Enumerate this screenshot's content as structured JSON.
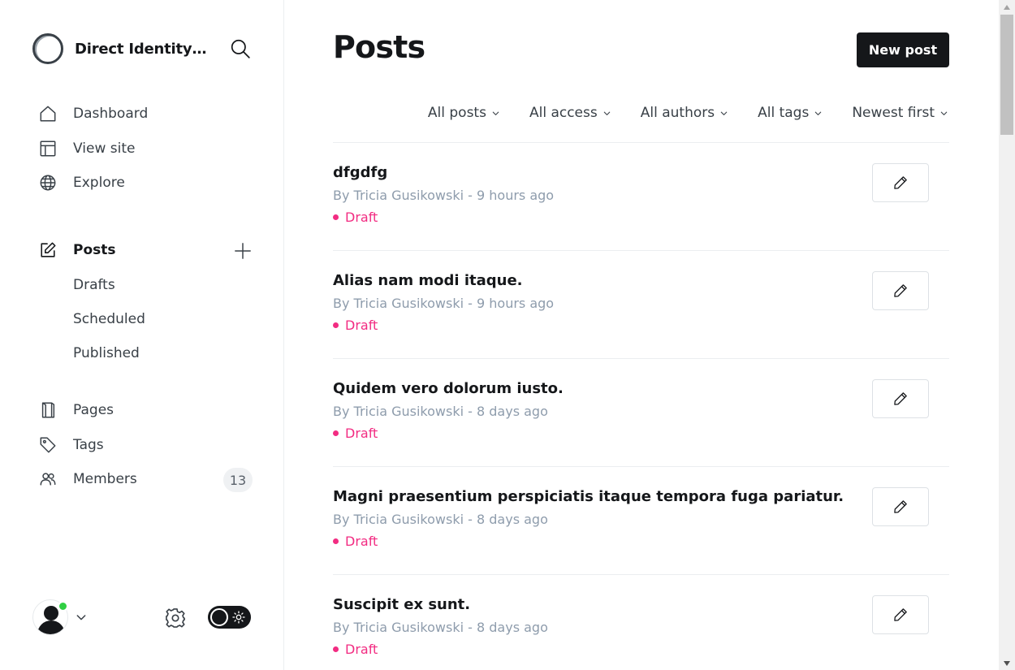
{
  "brand": {
    "name": "Direct Identity S...",
    "logo_icon": "ring-logo-icon"
  },
  "sidebar": {
    "top_items": [
      {
        "label": "Dashboard",
        "icon": "home-icon"
      },
      {
        "label": "View site",
        "icon": "layout-icon"
      },
      {
        "label": "Explore",
        "icon": "globe-icon"
      }
    ],
    "posts": {
      "label": "Posts",
      "icon": "pencil-square-icon",
      "sub_items": [
        "Drafts",
        "Scheduled",
        "Published"
      ]
    },
    "bottom_items": [
      {
        "label": "Pages",
        "icon": "page-icon"
      },
      {
        "label": "Tags",
        "icon": "tag-icon"
      },
      {
        "label": "Members",
        "icon": "users-icon",
        "count": "13"
      }
    ]
  },
  "header": {
    "title": "Posts",
    "new_post_label": "New post"
  },
  "filters": [
    "All posts",
    "All access",
    "All authors",
    "All tags",
    "Newest first"
  ],
  "posts": [
    {
      "title": "dfgdfg",
      "meta": "By Tricia Gusikowski - 9 hours ago",
      "status": "Draft"
    },
    {
      "title": "Alias nam modi itaque.",
      "meta": "By Tricia Gusikowski - 9 hours ago",
      "status": "Draft"
    },
    {
      "title": "Quidem vero dolorum iusto.",
      "meta": "By Tricia Gusikowski - 8 days ago",
      "status": "Draft"
    },
    {
      "title": "Magni praesentium perspiciatis itaque tempora fuga pariatur.",
      "meta": "By Tricia Gusikowski - 8 days ago",
      "status": "Draft"
    },
    {
      "title": "Suscipit ex sunt.",
      "meta": "By Tricia Gusikowski - 8 days ago",
      "status": "Draft"
    }
  ],
  "colors": {
    "accent": "#15171a",
    "draft": "#f22c82",
    "online": "#30cf43"
  }
}
